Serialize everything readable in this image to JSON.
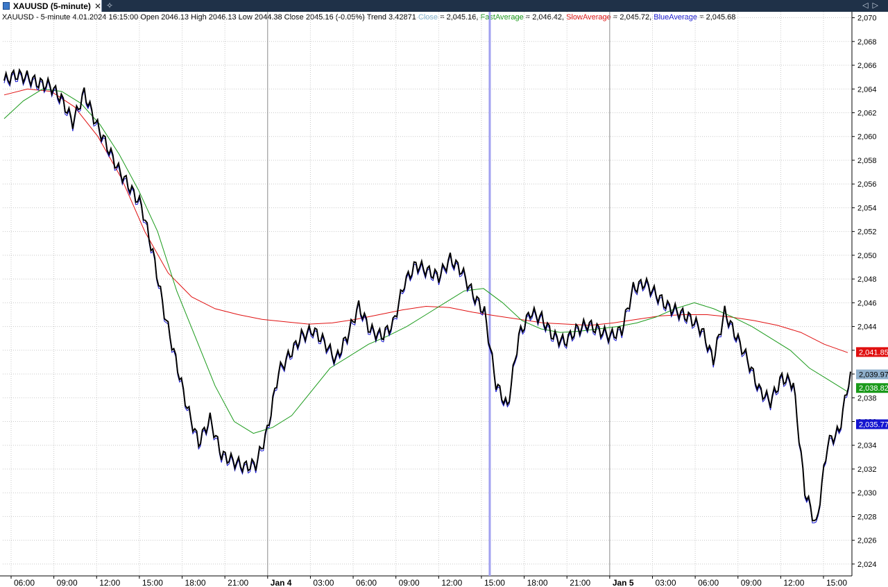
{
  "tab": {
    "label": "XAUUSD (5-minute)",
    "icon": "chart-icon"
  },
  "info": {
    "main": "XAUUSD - 5-minute 4.01.2024 16:15:00 Open 2046.13 High 2046.13 Low 2044.38 Close 2045.16 (-0.05%) Trend 3.42871",
    "close_label": "Close",
    "close_value": " = 2,045.16, ",
    "fast_label": "FastAverage",
    "fast_value": " = 2,046.42, ",
    "slow_label": "SlowAverage",
    "slow_value": " = 2,045.72, ",
    "blue_label": "BlueAverage",
    "blue_value": " = 2,045.68"
  },
  "colors": {
    "tabbar": "#1f3148",
    "fast": "#1a9a1a",
    "slow": "#e01010",
    "blue": "#1515d0",
    "close": "#7fb0cc",
    "crosshair": "#a0a0f0"
  },
  "chart_data": {
    "type": "line",
    "symbol": "XAUUSD",
    "interval": "5-minute",
    "ylim": [
      2023,
      2070.5
    ],
    "y_ticks": [
      "2,024",
      "2,026",
      "2,028",
      "2,030",
      "2,032",
      "2,034",
      "2,036",
      "2,038",
      "2,040",
      "2,042",
      "2,044",
      "2,046",
      "2,048",
      "2,050",
      "2,052",
      "2,054",
      "2,056",
      "2,058",
      "2,060",
      "2,062",
      "2,064",
      "2,066",
      "2,068",
      "2,070"
    ],
    "x_ticks": [
      {
        "label": "06:00",
        "bold": false
      },
      {
        "label": "09:00",
        "bold": false
      },
      {
        "label": "12:00",
        "bold": false
      },
      {
        "label": "15:00",
        "bold": false
      },
      {
        "label": "18:00",
        "bold": false
      },
      {
        "label": "21:00",
        "bold": false
      },
      {
        "label": "Jan 4",
        "bold": true
      },
      {
        "label": "03:00",
        "bold": false
      },
      {
        "label": "06:00",
        "bold": false
      },
      {
        "label": "09:00",
        "bold": false
      },
      {
        "label": "12:00",
        "bold": false
      },
      {
        "label": "15:00",
        "bold": false
      },
      {
        "label": "18:00",
        "bold": false
      },
      {
        "label": "21:00",
        "bold": false
      },
      {
        "label": "Jan 5",
        "bold": true
      },
      {
        "label": "03:00",
        "bold": false
      },
      {
        "label": "06:00",
        "bold": false
      },
      {
        "label": "09:00",
        "bold": false
      },
      {
        "label": "12:00",
        "bold": false
      },
      {
        "label": "15:00",
        "bold": false
      }
    ],
    "price_series": [
      2064.5,
      2065.0,
      2064.8,
      2064.3,
      2064.1,
      2063.0,
      2061.0,
      2063.5,
      2061.0,
      2059.0,
      2057.0,
      2055.5,
      2054.0,
      2050.0,
      2045.0,
      2041.0,
      2037.0,
      2034.0,
      2036.0,
      2033.0,
      2032.5,
      2032.0,
      2032.2,
      2035.0,
      2040.0,
      2041.5,
      2043.0,
      2043.5,
      2042.5,
      2041.0,
      2043.0,
      2045.5,
      2043.5,
      2043.0,
      2044.0,
      2047.5,
      2049.0,
      2048.5,
      2048.0,
      2049.5,
      2048.5,
      2046.5,
      2045.0,
      2039.0,
      2037.0,
      2043.0,
      2045.0,
      2044.5,
      2043.0,
      2042.5,
      2043.5,
      2044.0,
      2043.5,
      2043.0,
      2043.5,
      2047.0,
      2047.5,
      2046.5,
      2045.5,
      2045.0,
      2044.5,
      2043.5,
      2041.0,
      2045.0,
      2043.0,
      2041.0,
      2038.5,
      2037.5,
      2039.5,
      2039.0,
      2030.0,
      2027.0,
      2034.0,
      2035.0,
      2040.0
    ],
    "series": [
      {
        "name": "FastAverage",
        "color": "#1a9a1a",
        "values": [
          2061.5,
          2063.0,
          2064.0,
          2063.8,
          2062.8,
          2061.0,
          2058.5,
          2055.5,
          2052.0,
          2047.0,
          2043.0,
          2039.0,
          2036.0,
          2035.0,
          2035.5,
          2036.5,
          2038.5,
          2040.5,
          2041.5,
          2042.5,
          2043.2,
          2044.0,
          2045.0,
          2046.0,
          2047.0,
          2047.2,
          2046.0,
          2044.5,
          2043.8,
          2043.5,
          2043.6,
          2043.8,
          2044.0,
          2044.3,
          2044.8,
          2045.5,
          2046.0,
          2045.5,
          2044.8,
          2044.0,
          2043.0,
          2042.0,
          2040.5,
          2039.5,
          2038.5
        ]
      },
      {
        "name": "SlowAverage",
        "color": "#e01010",
        "values": [
          2063.5,
          2064.0,
          2063.8,
          2062.5,
          2060.0,
          2056.5,
          2052.0,
          2048.5,
          2046.5,
          2045.5,
          2045.0,
          2044.6,
          2044.4,
          2044.2,
          2044.3,
          2044.6,
          2045.0,
          2045.4,
          2045.7,
          2045.6,
          2045.2,
          2044.9,
          2044.6,
          2044.3,
          2044.2,
          2044.1,
          2044.3,
          2044.6,
          2044.9,
          2045.0,
          2045.0,
          2044.8,
          2044.5,
          2044.1,
          2043.5,
          2042.5,
          2041.8
        ]
      },
      {
        "name": "BlueAverage",
        "color": "#1515d0"
      }
    ],
    "last_labels": [
      {
        "text": "2,041.85",
        "value": 2041.85,
        "color": "#e01010",
        "text_color": "#ffffff"
      },
      {
        "text": "2,039.97",
        "value": 2039.97,
        "color": "#8fb0cc",
        "text_color": "#000000"
      },
      {
        "text": "2,038.82",
        "value": 2038.82,
        "color": "#1a9a1a",
        "text_color": "#ffffff"
      },
      {
        "text": "2,035.77",
        "value": 2035.77,
        "color": "#1515d0",
        "text_color": "#ffffff"
      }
    ],
    "grid": true,
    "crosshair": "4.01.2024 16:15:00"
  }
}
